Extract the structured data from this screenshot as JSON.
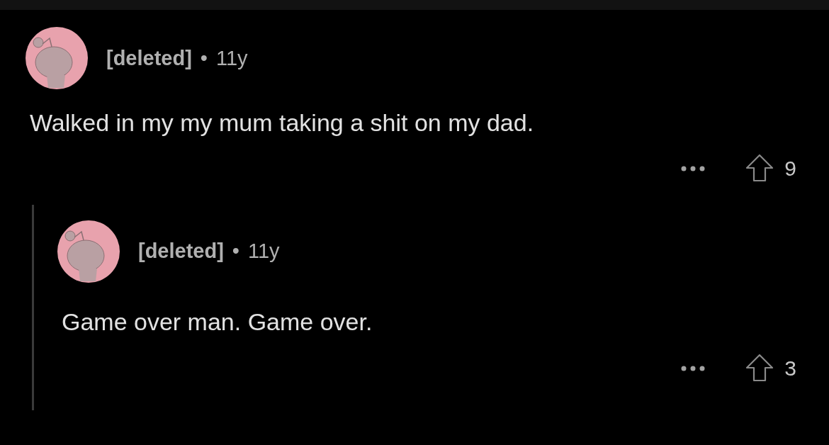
{
  "comment": {
    "author": "[deleted]",
    "separator": "•",
    "age": "11y",
    "body": "Walked in my my mum taking a shit on my dad.",
    "score": "9",
    "replies": [
      {
        "author": "[deleted]",
        "separator": "•",
        "age": "11y",
        "body": "Game over man. Game over.",
        "score": "3"
      }
    ]
  }
}
